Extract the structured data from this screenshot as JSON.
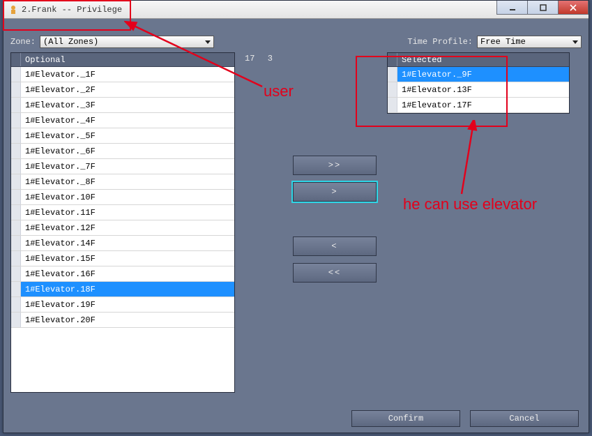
{
  "window": {
    "title": "2.Frank -- Privilege"
  },
  "filters": {
    "zone_label": "Zone:",
    "zone_value": "(All Zones)",
    "time_label": "Time Profile:",
    "time_value": "Free Time"
  },
  "counts": {
    "left": "17",
    "right": "3"
  },
  "lists": {
    "optional": {
      "header": "Optional",
      "items": [
        "1#Elevator._1F",
        "1#Elevator._2F",
        "1#Elevator._3F",
        "1#Elevator._4F",
        "1#Elevator._5F",
        "1#Elevator._6F",
        "1#Elevator._7F",
        "1#Elevator._8F",
        "1#Elevator.10F",
        "1#Elevator.11F",
        "1#Elevator.12F",
        "1#Elevator.14F",
        "1#Elevator.15F",
        "1#Elevator.16F",
        "1#Elevator.18F",
        "1#Elevator.19F",
        "1#Elevator.20F"
      ],
      "selected_index": 14
    },
    "selected": {
      "header": "Selected",
      "items": [
        "1#Elevator._9F",
        "1#Elevator.13F",
        "1#Elevator.17F"
      ],
      "selected_index": 0
    }
  },
  "buttons": {
    "add_all": ">>",
    "add_one": ">",
    "remove_one": "<",
    "remove_all": "<<",
    "confirm": "Confirm",
    "cancel": "Cancel"
  },
  "annotations": {
    "user": "user",
    "he_can": "he can use elevator"
  }
}
